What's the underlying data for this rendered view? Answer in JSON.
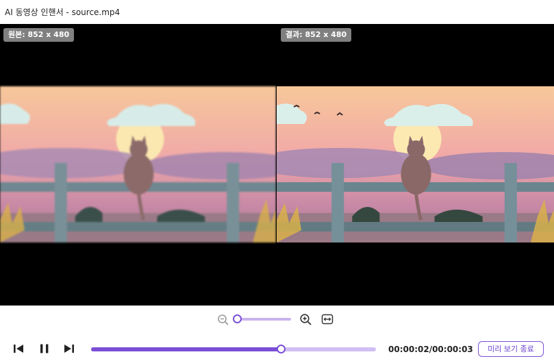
{
  "window": {
    "title": "AI 동영상 인핸서 - source.mp4"
  },
  "preview": {
    "original_label": "원본: 852 x 480",
    "result_label": "결과: 852 x 480"
  },
  "zoom": {
    "level_fraction": 0.05
  },
  "playback": {
    "time_display": "00:00:02/00:00:03",
    "progress_fraction": 0.667,
    "end_preview_label": "미리 보기 종료"
  },
  "colors": {
    "accent": "#7a4fd6",
    "accent_light": "#d0bff2"
  },
  "icons": {
    "zoom_out": "zoom-out-icon",
    "zoom_in": "zoom-in-icon",
    "fit": "fit-width-icon",
    "prev": "previous-frame-icon",
    "pause": "pause-icon",
    "next": "next-frame-icon"
  }
}
